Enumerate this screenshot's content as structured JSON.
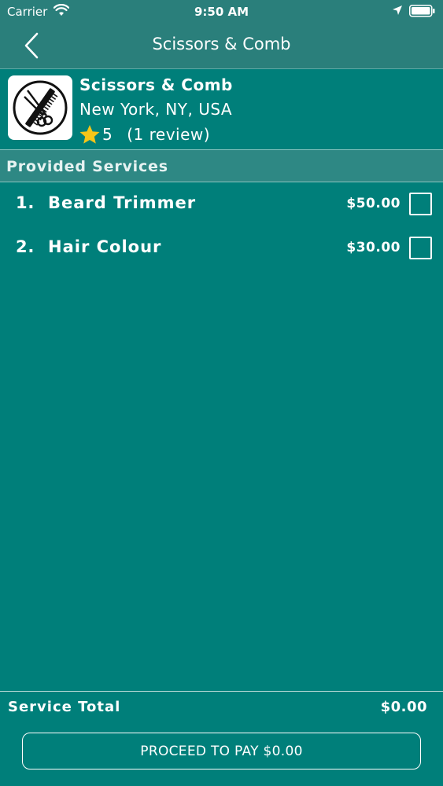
{
  "status_bar": {
    "carrier": "Carrier",
    "time": "9:50 AM"
  },
  "nav": {
    "title": "Scissors & Comb"
  },
  "shop": {
    "name": "Scissors & Comb",
    "location": "New York, NY, USA",
    "rating": "5",
    "reviews": "(1 review)"
  },
  "services": {
    "section_title": "Provided Services",
    "items": [
      {
        "number": "1.",
        "name": "Beard Trimmer",
        "price": "$50.00",
        "checked": false
      },
      {
        "number": "2.",
        "name": "Hair Colour",
        "price": "$30.00",
        "checked": false
      }
    ]
  },
  "footer": {
    "total_label": "Service Total",
    "total_value": "$0.00",
    "pay_button_label": "PROCEED TO PAY $0.00"
  },
  "colors": {
    "background": "#007f7a",
    "header": "#2a7f7b",
    "section_header": "#2e8884",
    "star": "#f5c518"
  }
}
